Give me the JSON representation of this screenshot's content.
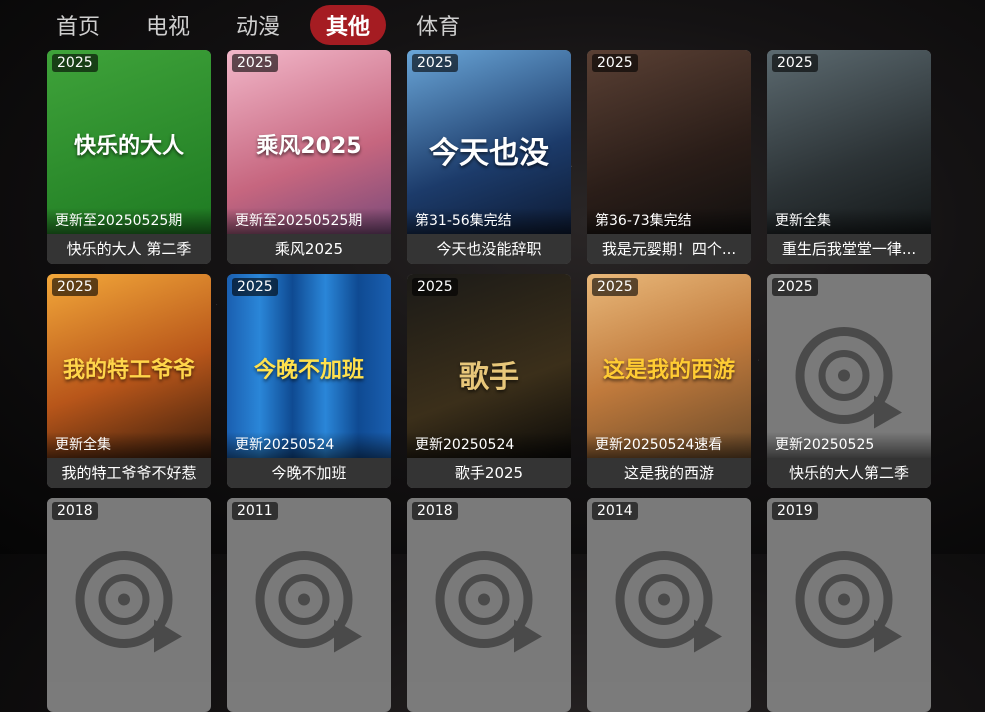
{
  "tabs": [
    "首页",
    "电视",
    "动漫",
    "其他",
    "体育"
  ],
  "active_tab": "其他",
  "cards": [
    {
      "year": "2025",
      "status": "更新至20250525期",
      "title": "快乐的大人 第二季",
      "poster_text": "快乐的大人",
      "poster_style": "green"
    },
    {
      "year": "2025",
      "status": "更新至20250525期",
      "title": "乘风2025",
      "poster_text": "乘风2025",
      "poster_style": "pink"
    },
    {
      "year": "2025",
      "status": "第31-56集完结",
      "title": "今天也没能辞职",
      "poster_text": "今天也没",
      "poster_style": "blue"
    },
    {
      "year": "2025",
      "status": "第36-73集完结",
      "title": "我是元婴期！四个...",
      "poster_text": "",
      "poster_style": "dark"
    },
    {
      "year": "2025",
      "status": "更新全集",
      "title": "重生后我堂堂一律...",
      "poster_text": "",
      "poster_style": "grey"
    },
    {
      "year": "2025",
      "status": "更新全集",
      "title": "我的特工爷爷不好惹",
      "poster_text": "我的特工爷爷",
      "poster_style": "orange"
    },
    {
      "year": "2025",
      "status": "更新20250524",
      "title": "今晚不加班",
      "poster_text": "今晚不加班",
      "poster_style": "curtain"
    },
    {
      "year": "2025",
      "status": "更新20250524",
      "title": "歌手2025",
      "poster_text": "歌手",
      "poster_style": "gold"
    },
    {
      "year": "2025",
      "status": "更新20250524速看",
      "title": "这是我的西游",
      "poster_text": "这是我的西游",
      "poster_style": "city"
    },
    {
      "year": "2025",
      "status": "更新20250525",
      "title": "快乐的大人第二季",
      "poster_text": "",
      "poster_style": "placeholder"
    },
    {
      "year": "2018",
      "status": "",
      "title": "",
      "poster_text": "",
      "poster_style": "placeholder"
    },
    {
      "year": "2011",
      "status": "",
      "title": "",
      "poster_text": "",
      "poster_style": "placeholder"
    },
    {
      "year": "2018",
      "status": "",
      "title": "",
      "poster_text": "",
      "poster_style": "placeholder"
    },
    {
      "year": "2014",
      "status": "",
      "title": "",
      "poster_text": "",
      "poster_style": "placeholder"
    },
    {
      "year": "2019",
      "status": "",
      "title": "",
      "poster_text": "",
      "poster_style": "placeholder"
    }
  ]
}
